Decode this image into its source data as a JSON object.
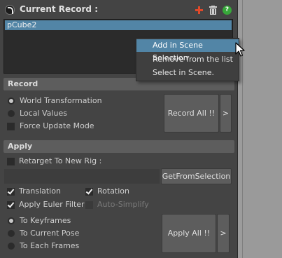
{
  "header": {
    "title": "Current Record :",
    "icons": [
      "logo-icon",
      "plus-icon",
      "trash-icon",
      "help-icon"
    ],
    "help_glyph": "?"
  },
  "record_list": {
    "items": [
      "pCube2"
    ]
  },
  "context_menu": {
    "items": [
      "Add in Scene Selection",
      "Remove from the list",
      "Select in Scene."
    ],
    "highlighted": "Add in Scene Selection"
  },
  "record_section": {
    "title": "Record",
    "options": {
      "world_transformation": "World Transformation",
      "local_values": "Local Values"
    },
    "selected_option": "World Transformation",
    "force_update_label": "Force Update Mode",
    "record_all_label": "Record All !!",
    "more_label": ">"
  },
  "apply_section": {
    "title": "Apply",
    "retarget_label": "Retarget To New Rig :",
    "get_from_selection_label": "GetFromSelection",
    "translation_label": "Translation",
    "rotation_label": "Rotation",
    "apply_euler_label": "Apply Euler Filter",
    "auto_simplify_label": "Auto-Simplify",
    "modes": {
      "to_keyframes": "To Keyframes",
      "to_current_pose": "To Current Pose",
      "to_each_frames": "To Each Frames"
    },
    "selected_mode": "To Keyframes",
    "apply_all_label": "Apply All !!",
    "more_label": ">"
  },
  "colors": {
    "panel_bg": "#444444",
    "selection_blue": "#5285a6",
    "section_bar": "#5d5d5d",
    "add_red": "#e0492a",
    "help_green": "#37a83a"
  }
}
